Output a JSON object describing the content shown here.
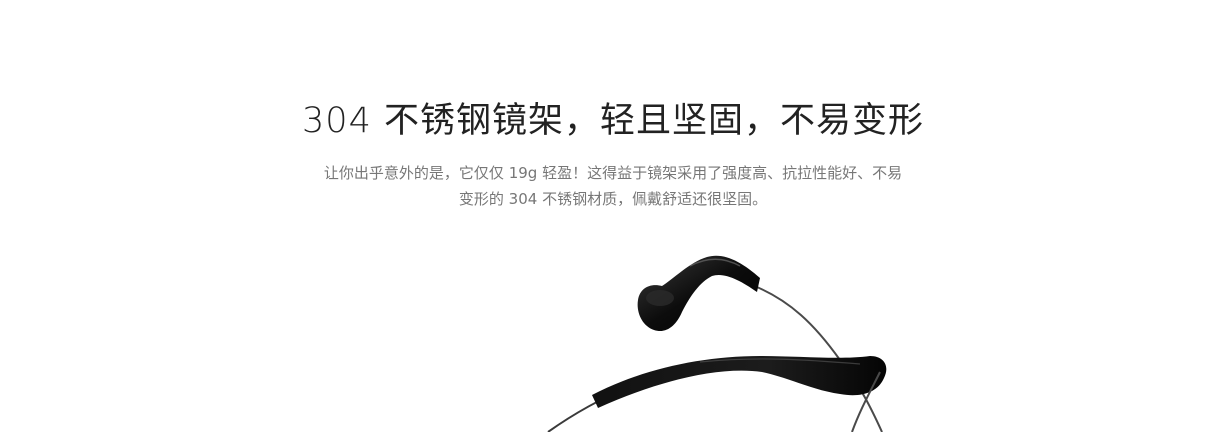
{
  "feature": {
    "headline": "304 不锈钢镜架，轻且坚固，不易变形",
    "description_lines": [
      "让你出乎意外的是，它仅仅 19g 轻盈！这得益于镜架采用了强度高、抗拉性能好、不易",
      "变形的 304 不锈钢材质，佩戴舒适还很坚固。"
    ]
  }
}
